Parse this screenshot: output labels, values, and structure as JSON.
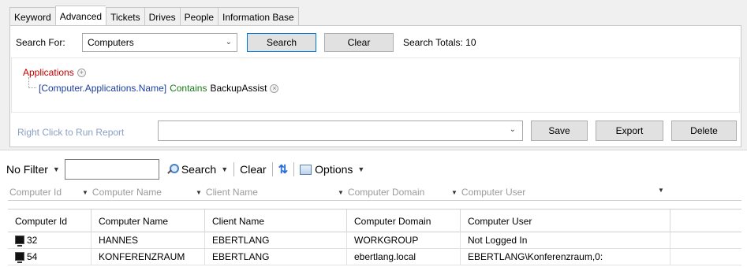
{
  "tabs": [
    "Keyword",
    "Advanced",
    "Tickets",
    "Drives",
    "People",
    "Information Base"
  ],
  "active_tab": "Advanced",
  "search": {
    "for_label": "Search For:",
    "for_value": "Computers",
    "search_button": "Search",
    "clear_button": "Clear",
    "totals": "Search Totals: 10"
  },
  "query": {
    "root": "Applications",
    "condition_field": "[Computer.Applications.Name]",
    "condition_operator": "Contains",
    "condition_value": "BackupAssist"
  },
  "report": {
    "label": "Right Click to Run Report",
    "selected": "",
    "save_button": "Save",
    "export_button": "Export",
    "delete_button": "Delete"
  },
  "grid_toolbar": {
    "filter": "No Filter",
    "filter_input": "",
    "search": "Search",
    "clear": "Clear",
    "options": "Options"
  },
  "filter_row": [
    "Computer Id",
    "Computer Name",
    "Client Name",
    "Computer Domain",
    "Computer User"
  ],
  "columns": [
    "Computer Id",
    "Computer Name",
    "Client Name",
    "Computer Domain",
    "Computer User"
  ],
  "rows": [
    [
      "32",
      "HANNES",
      "EBERTLANG",
      "WORKGROUP",
      "Not Logged In"
    ],
    [
      "54",
      "KONFERENZRAUM",
      "EBERTLANG",
      "ebertlang.local",
      "EBERTLANG\\Konferenzraum,0:"
    ]
  ],
  "colors": {
    "root_condition": "#c00000",
    "field": "#1f3ea1",
    "operator": "#1a7a1a",
    "report_label": "#8aa0c2",
    "focus_border": "#0078d7"
  },
  "icons": {
    "add_condition": "plus-circle-icon",
    "remove_condition": "x-circle-icon",
    "search": "magnifier-icon",
    "refresh": "refresh-icon",
    "options": "options-icon",
    "computer": "computer-icon"
  }
}
